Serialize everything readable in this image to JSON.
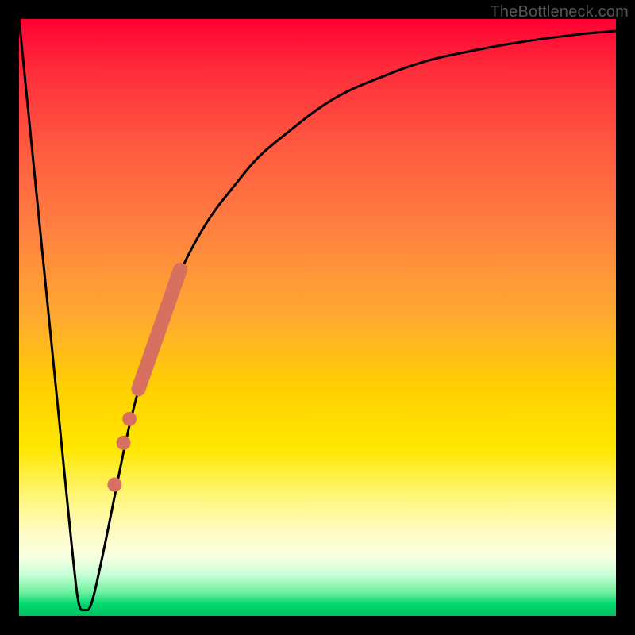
{
  "watermark": "TheBottleneck.com",
  "colors": {
    "frame": "#000000",
    "curve": "#000000",
    "marker_fill": "#d8705f",
    "gradient_top": "#ff0033",
    "gradient_bottom": "#00c060"
  },
  "chart_data": {
    "type": "line",
    "title": "",
    "xlabel": "",
    "ylabel": "",
    "xlim": [
      0,
      100
    ],
    "ylim": [
      0,
      100
    ],
    "grid": false,
    "legend": false,
    "series": [
      {
        "name": "bottleneck-curve",
        "x": [
          0,
          2,
          4,
          6,
          8,
          9,
          10,
          11,
          12,
          14,
          16,
          18,
          20,
          22,
          25,
          28,
          32,
          36,
          40,
          45,
          50,
          55,
          60,
          65,
          70,
          75,
          80,
          85,
          90,
          95,
          100
        ],
        "values": [
          100,
          80,
          60,
          40,
          20,
          10,
          1,
          1,
          1,
          10,
          20,
          30,
          38,
          45,
          53,
          60,
          67,
          72,
          77,
          81,
          85,
          88,
          90,
          92,
          93.5,
          94.5,
          95.5,
          96.3,
          97,
          97.6,
          98
        ]
      }
    ],
    "markers": [
      {
        "name": "highlight-segment",
        "shape": "thick-line",
        "x_start": 20,
        "y_start": 38,
        "x_end": 27,
        "y_end": 58
      },
      {
        "name": "dot-1",
        "shape": "circle",
        "x": 18.5,
        "y": 33
      },
      {
        "name": "dot-2",
        "shape": "circle",
        "x": 17.5,
        "y": 29
      },
      {
        "name": "dot-3",
        "shape": "circle",
        "x": 16.0,
        "y": 22
      }
    ]
  }
}
